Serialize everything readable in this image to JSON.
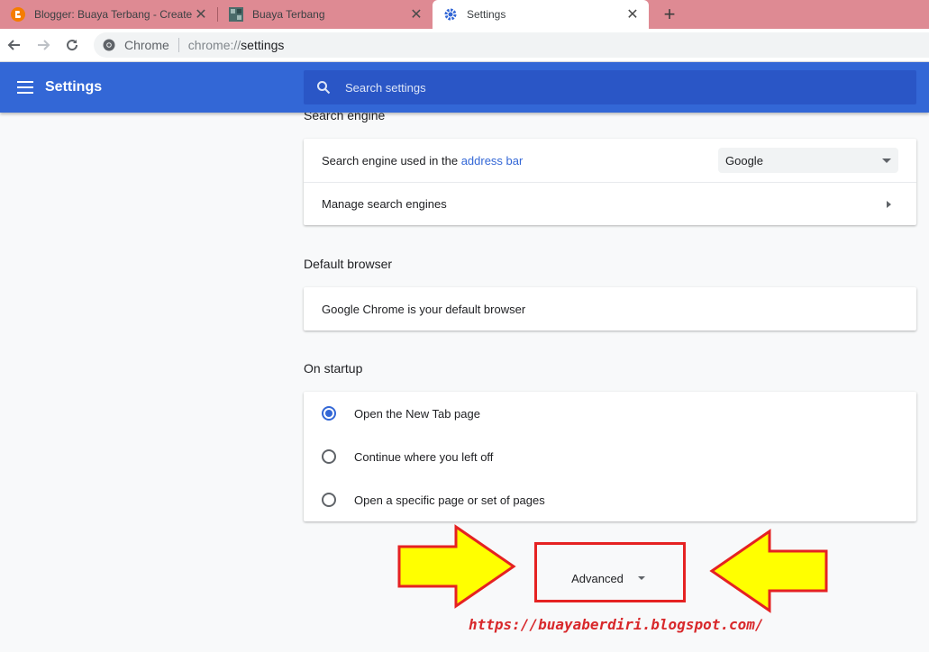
{
  "browser": {
    "tabs": [
      {
        "title": "Blogger: Buaya Terbang - Create",
        "favicon": "blogger-icon"
      },
      {
        "title": "Buaya Terbang",
        "favicon": "site-icon"
      },
      {
        "title": "Settings",
        "favicon": "gear-icon"
      }
    ],
    "new_tab_label": "+",
    "close_label": "✕",
    "omnibox": {
      "chip": "Chrome",
      "url_scheme": "chrome://",
      "url_path": "settings"
    }
  },
  "header": {
    "title": "Settings",
    "search_placeholder": "Search settings"
  },
  "search_engine": {
    "section_title": "Search engine",
    "used_in_prefix": "Search engine used in the ",
    "used_in_link": "address bar",
    "selected": "Google",
    "manage_label": "Manage search engines"
  },
  "default_browser": {
    "section_title": "Default browser",
    "status": "Google Chrome is your default browser"
  },
  "on_startup": {
    "section_title": "On startup",
    "options": [
      {
        "label": "Open the New Tab page",
        "checked": true
      },
      {
        "label": "Continue where you left off",
        "checked": false
      },
      {
        "label": "Open a specific page or set of pages",
        "checked": false
      }
    ]
  },
  "advanced": {
    "label": "Advanced"
  },
  "watermark": "https://buayaberdiri.blogspot.com/",
  "colors": {
    "header": "#3367d6",
    "accent": "#3367d6",
    "highlight": "#e52222",
    "arrow": "#ffff00"
  }
}
